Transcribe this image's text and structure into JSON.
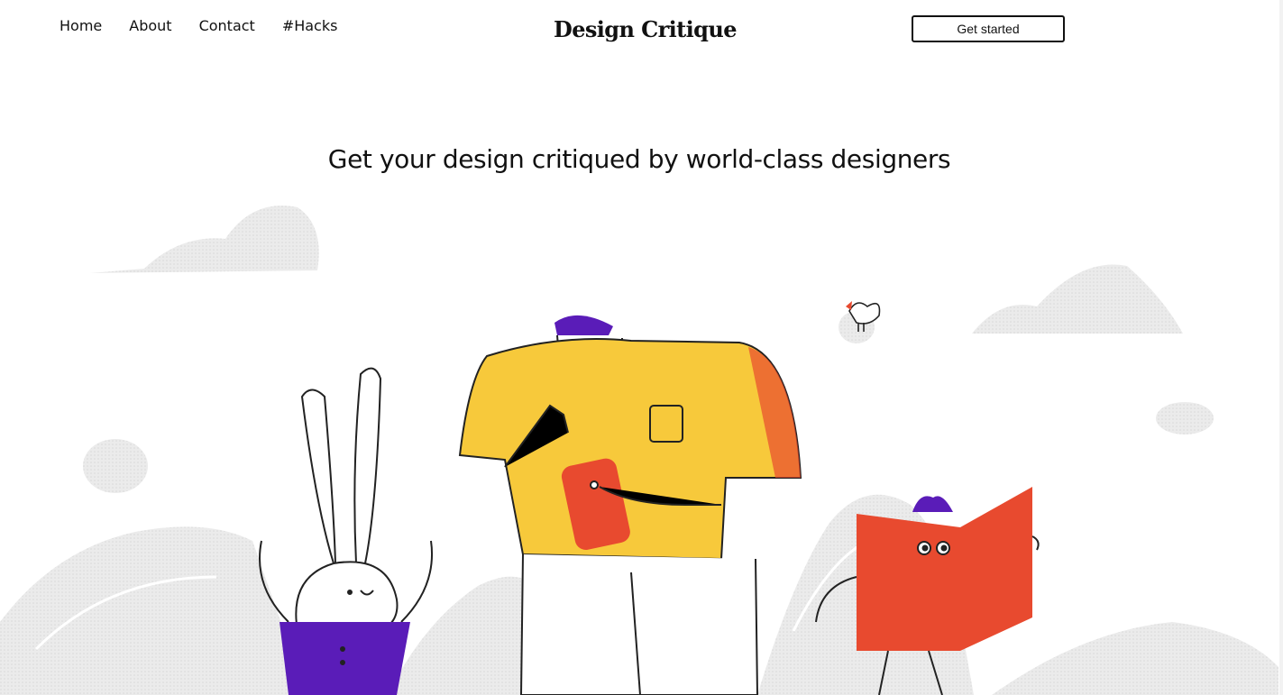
{
  "nav": {
    "links": [
      {
        "label": "Home"
      },
      {
        "label": "About"
      },
      {
        "label": "Contact"
      },
      {
        "label": "#Hacks"
      }
    ],
    "logo": "Design Critique",
    "cta_label": "Get started"
  },
  "hero": {
    "headline": "Get your design critiqued by world-class designers"
  },
  "colors": {
    "yellow": "#f7c93b",
    "red": "#e84a2f",
    "purple": "#5a1cb8",
    "gray": "#e8e8e8"
  },
  "icons": [
    "bunny-character",
    "man-character",
    "bird-character",
    "child-reading-character"
  ]
}
